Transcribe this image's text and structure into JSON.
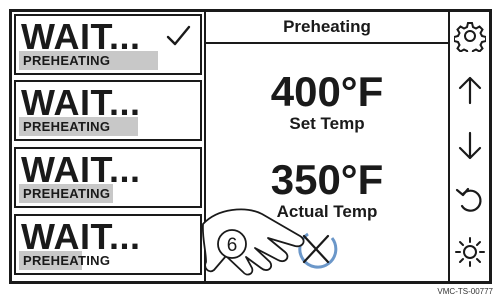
{
  "slots": [
    {
      "status": "WAIT...",
      "label": "PREHEATING",
      "progress": 0.77,
      "checked": true
    },
    {
      "status": "WAIT...",
      "label": "PREHEATING",
      "progress": 0.66,
      "checked": false
    },
    {
      "status": "WAIT...",
      "label": "PREHEATING",
      "progress": 0.52,
      "checked": false
    },
    {
      "status": "WAIT...",
      "label": "PREHEATING",
      "progress": 0.35,
      "checked": false
    }
  ],
  "center": {
    "title": "Preheating",
    "set_temp": {
      "value": "400°F",
      "caption": "Set Temp"
    },
    "actual_temp": {
      "value": "350°F",
      "caption": "Actual Temp"
    }
  },
  "icons": [
    "gear-icon",
    "arrow-up-icon",
    "arrow-down-icon",
    "undo-icon",
    "brightness-icon"
  ],
  "callout": {
    "number": "6"
  },
  "footer": {
    "code": "VMC-TS-00777"
  }
}
